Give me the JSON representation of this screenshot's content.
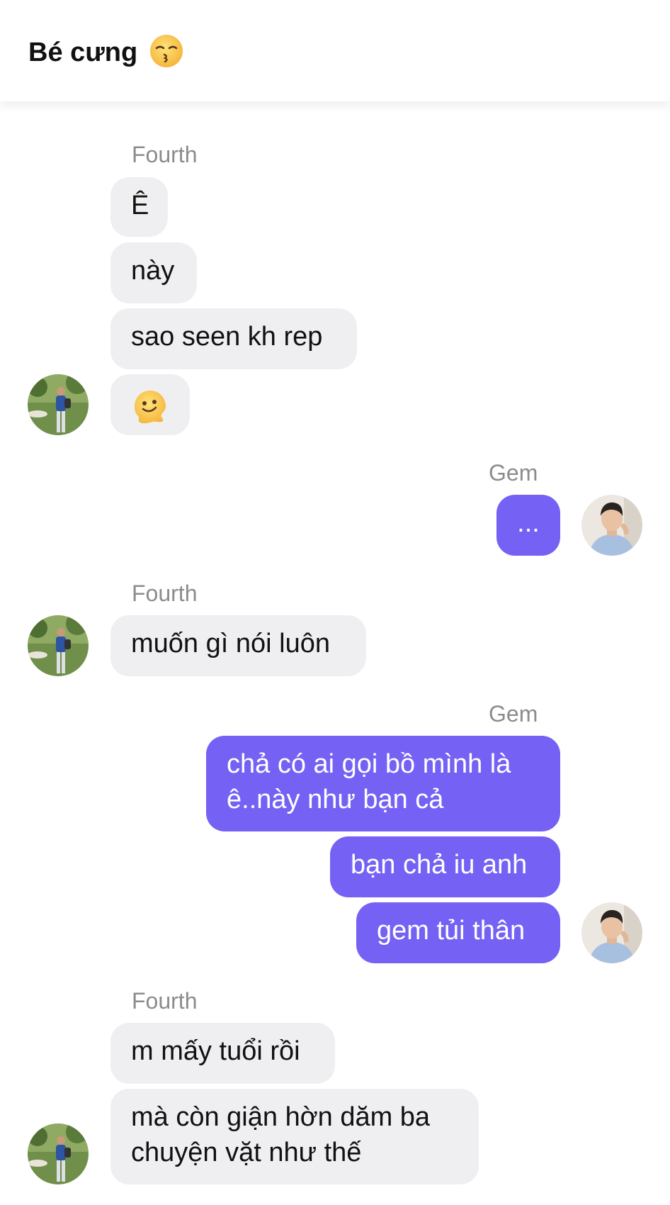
{
  "header": {
    "title": "Bé cưng",
    "title_emoji": "kissing-face-with-closed-eyes-icon"
  },
  "colors": {
    "outgoing_bubble": "#7561f4",
    "incoming_bubble": "#efeff1",
    "sender_label": "#8c8c8c"
  },
  "conversation": {
    "group1": {
      "sender": "Fourth",
      "messages": [
        "Ê",
        "này",
        "sao seen kh rep"
      ],
      "emoji_message": "melting-face-icon"
    },
    "group2": {
      "sender": "Gem",
      "messages": [
        "..."
      ]
    },
    "group3": {
      "sender": "Fourth",
      "messages": [
        "muốn gì nói luôn"
      ]
    },
    "group4": {
      "sender": "Gem",
      "messages": [
        "chả có ai gọi bồ mình là",
        "ê..này như bạn cả",
        "bạn chả iu anh",
        "gem tủi thân"
      ]
    },
    "group5": {
      "sender": "Fourth",
      "messages": [
        "m mấy tuổi rồi",
        "mà còn giận hờn dăm ba",
        "chuyện vặt như thế"
      ]
    }
  }
}
